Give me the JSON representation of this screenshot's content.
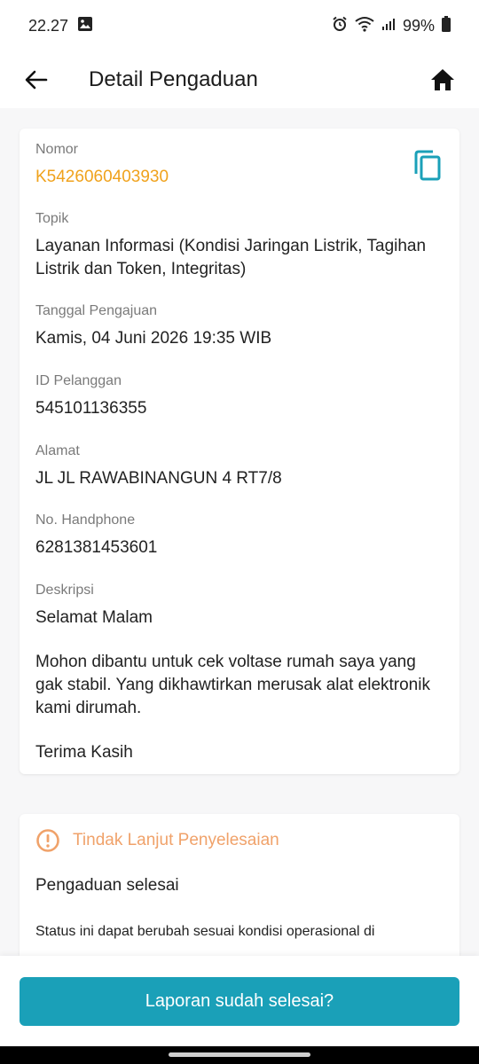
{
  "status_bar": {
    "time": "22.27",
    "battery": "99%"
  },
  "app_bar": {
    "title": "Detail Pengaduan"
  },
  "detail": {
    "nomor_label": "Nomor",
    "nomor_value": "K5426060403930",
    "topik_label": "Topik",
    "topik_value": "Layanan Informasi (Kondisi Jaringan Listrik, Tagihan Listrik dan Token, Integritas)",
    "tanggal_label": "Tanggal Pengajuan",
    "tanggal_value": "Kamis, 04 Juni 2026 19:35 WIB",
    "idpel_label": "ID Pelanggan",
    "idpel_value": "545101136355",
    "alamat_label": "Alamat",
    "alamat_value": "JL JL RAWABINANGUN 4 RT7/8",
    "hp_label": "No. Handphone",
    "hp_value": "6281381453601",
    "deskripsi_label": "Deskripsi",
    "deskripsi_p1": "Selamat Malam",
    "deskripsi_p2": "Mohon dibantu untuk cek voltase rumah saya yang gak stabil. Yang dikhawtirkan merusak alat elektronik kami dirumah.",
    "deskripsi_p3": "Terima Kasih"
  },
  "tindak_lanjut": {
    "title": "Tindak Lanjut Penyelesaian",
    "status": "Pengaduan selesai",
    "note": "Status ini dapat berubah sesuai kondisi operasional di"
  },
  "bottom": {
    "button_label": "Laporan sudah selesai?"
  },
  "colors": {
    "accent_orange": "#f0a21c",
    "teal": "#1aa0b8",
    "warning": "#f0a26a"
  },
  "icons": [
    "image-icon",
    "alarm-icon",
    "wifi-icon",
    "signal-icon",
    "battery-icon",
    "back-arrow-icon",
    "home-icon",
    "copy-icon",
    "warning-circle-icon"
  ]
}
